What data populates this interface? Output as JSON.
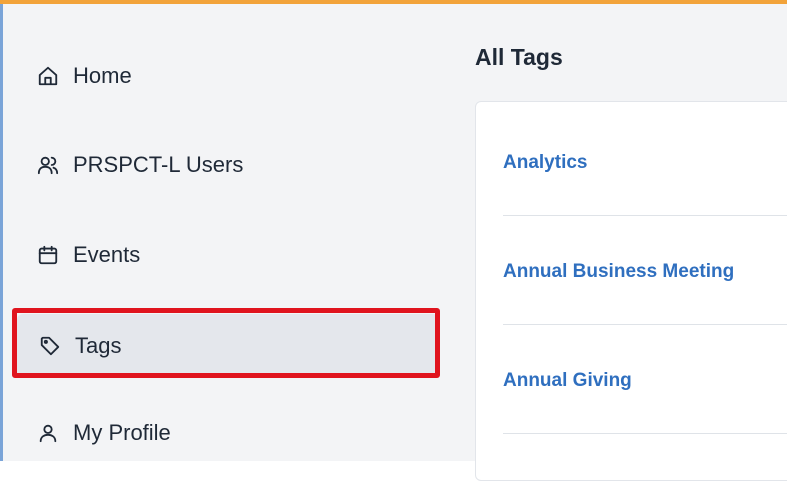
{
  "sidebar": {
    "items": [
      {
        "label": "Home",
        "icon": "home-icon"
      },
      {
        "label": "PRSPCT-L Users",
        "icon": "users-icon"
      },
      {
        "label": "Events",
        "icon": "calendar-icon"
      },
      {
        "label": "Tags",
        "icon": "tag-icon",
        "active": true
      },
      {
        "label": "My Profile",
        "icon": "user-icon"
      }
    ]
  },
  "main": {
    "title": "All Tags",
    "tags": [
      "Analytics",
      "Annual Business Meeting",
      "Annual Giving"
    ]
  },
  "colors": {
    "accent_top": "#f2a33a",
    "link": "#2f6fbf",
    "highlight": "#e0141e"
  }
}
